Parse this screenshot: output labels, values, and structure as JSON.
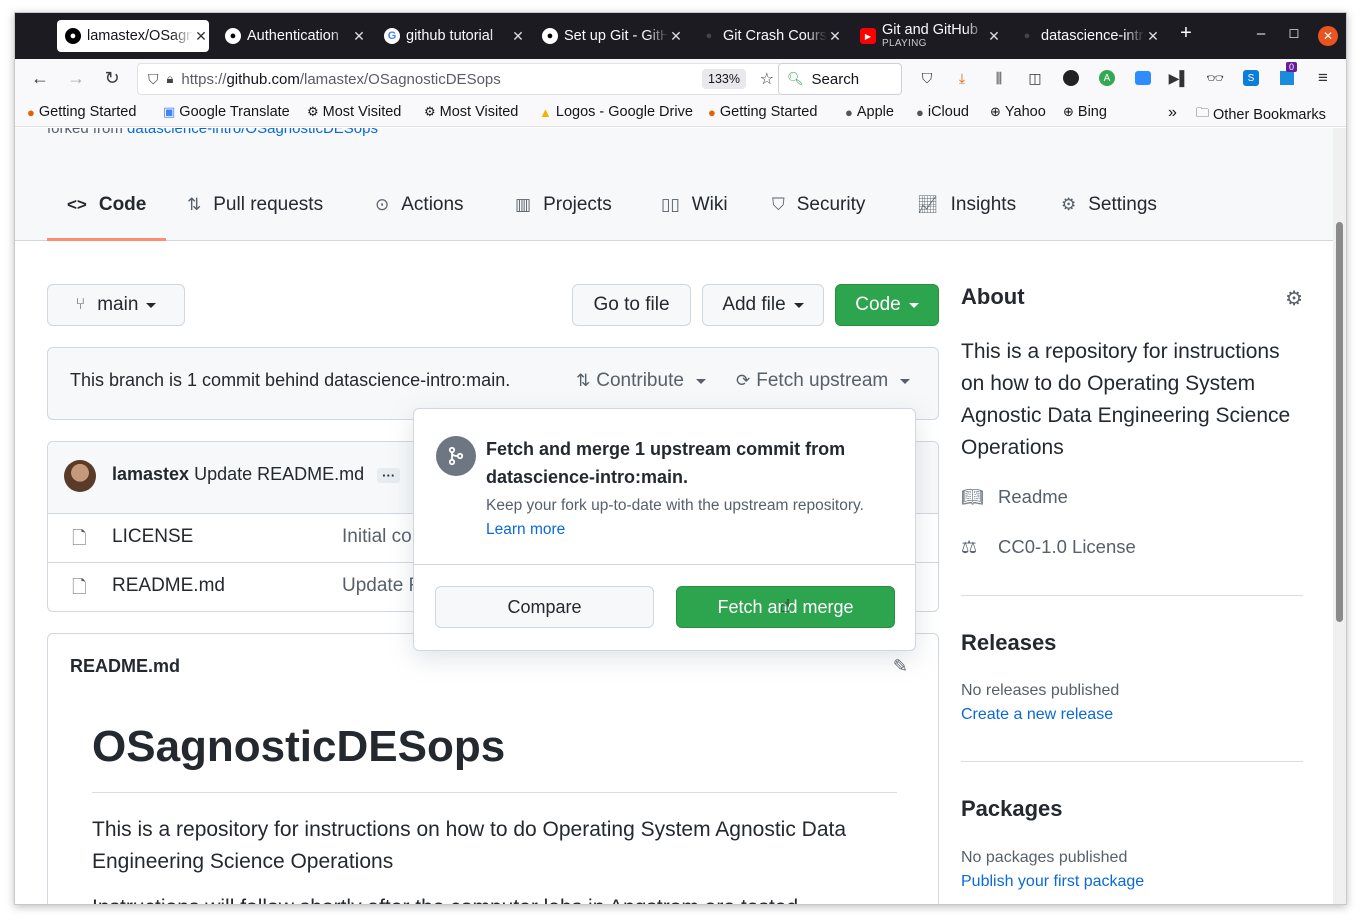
{
  "browser": {
    "tabs": [
      {
        "label": "lamastex/OSagnosticDESops",
        "icon": "github-icon",
        "active": true
      },
      {
        "label": "Authentication",
        "icon": "github-icon"
      },
      {
        "label": "github tutorial",
        "icon": "google-icon"
      },
      {
        "label": "Set up Git - GitHub",
        "icon": "github-icon"
      },
      {
        "label": "Git Crash Course",
        "icon": "github-icon"
      },
      {
        "label": "Git and GitHub",
        "sub": "PLAYING",
        "icon": "youtube-icon"
      },
      {
        "label": "datascience-intro",
        "icon": "github-icon"
      }
    ],
    "url_prefix": "https://",
    "url_host": "github.com",
    "url_path": "/lamastex/OSagnosticDESops",
    "zoom": "133%",
    "search_label": "Search",
    "bookmarks": [
      {
        "label": "Getting Started",
        "icon": "firefox-icon"
      },
      {
        "label": "Google Translate",
        "icon": "translate-icon"
      },
      {
        "label": "Most Visited",
        "icon": "gear-icon"
      },
      {
        "label": "Most Visited",
        "icon": "gear-icon"
      },
      {
        "label": "Logos - Google Drive",
        "icon": "drive-icon"
      },
      {
        "label": "Getting Started",
        "icon": "firefox-icon"
      },
      {
        "label": "Apple",
        "icon": "apple-icon"
      },
      {
        "label": "iCloud",
        "icon": "apple-icon"
      },
      {
        "label": "Yahoo",
        "icon": "globe-icon"
      },
      {
        "label": "Bing",
        "icon": "globe-icon"
      }
    ],
    "other_bookmarks": "Other Bookmarks",
    "extension_badge": "0"
  },
  "repo": {
    "forked_prefix": "forked from ",
    "forked_link": "datascience-intro/OSagnosticDESops",
    "nav": [
      {
        "label": "Code",
        "icon": "<>"
      },
      {
        "label": "Pull requests"
      },
      {
        "label": "Actions"
      },
      {
        "label": "Projects"
      },
      {
        "label": "Wiki"
      },
      {
        "label": "Security"
      },
      {
        "label": "Insights"
      },
      {
        "label": "Settings"
      }
    ],
    "branch": "main",
    "go_to_file": "Go to file",
    "add_file": "Add file",
    "code_btn": "Code",
    "branch_status": "This branch is 1 commit behind datascience-intro:main.",
    "contribute": "Contribute",
    "fetch_upstream": "Fetch upstream",
    "commit_author": "lamastex",
    "commit_msg": "Update README.md",
    "files": [
      {
        "name": "LICENSE",
        "msg": "Initial commit"
      },
      {
        "name": "README.md",
        "msg": "Update README.md"
      }
    ],
    "readme_header": "README.md",
    "readme_title": "OSagnosticDESops",
    "readme_p1": "This is a repository for instructions on how to do Operating System Agnostic Data Engineering Science Operations",
    "readme_p2": "Instructions will follow shortly after the computer labs in Angstrom are tested."
  },
  "sidebar": {
    "about_title": "About",
    "about_desc": "This is a repository for instructions on how to do Operating System Agnostic Data Engineering Science Operations",
    "readme": "Readme",
    "license": "CC0-1.0 License",
    "releases_title": "Releases",
    "releases_none": "No releases published",
    "releases_link": "Create a new release",
    "packages_title": "Packages",
    "packages_none": "No packages published",
    "packages_link": "Publish your first package"
  },
  "popup": {
    "title": "Fetch and merge 1 upstream commit from datascience-intro:main.",
    "desc": "Keep your fork up-to-date with the upstream repository.",
    "learn_more": "Learn more",
    "compare": "Compare",
    "fetch_merge": "Fetch and merge"
  },
  "colors": {
    "accent_green": "#2da44e",
    "link_blue": "#0969da",
    "tab_underline": "#fd8c73",
    "browser_dark": "#1c1b22"
  }
}
